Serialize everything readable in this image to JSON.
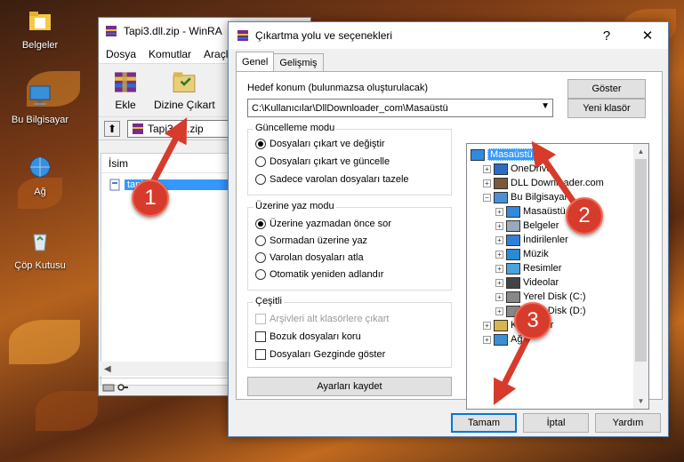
{
  "desktop": {
    "icons": [
      {
        "label": "Belgeler",
        "icon": "folder-icon"
      },
      {
        "label": "Bu Bilgisayar",
        "icon": "computer-icon"
      },
      {
        "label": "Ağ",
        "icon": "network-icon"
      },
      {
        "label": "Çöp Kutusu",
        "icon": "recycle-bin-icon"
      }
    ]
  },
  "winrar": {
    "title": "Tapi3.dll.zip - WinRA",
    "menu": [
      "Dosya",
      "Komutlar",
      "Araçla"
    ],
    "toolbar": {
      "add_label": "Ekle",
      "extract_label": "Dizine Çıkart"
    },
    "path": "Tapi3.dll.zip",
    "list_header": "İsim",
    "file_name": "tapi3.dll",
    "file_name_visible": "tapi3"
  },
  "dialog": {
    "title": "Çıkartma yolu ve seçenekleri",
    "help_glyph": "?",
    "close_glyph": "✕",
    "tabs": [
      "Genel",
      "Gelişmiş"
    ],
    "dest_label": "Hedef konum (bulunmazsa oluşturulacak)",
    "dest_value": "C:\\Kullanıcılar\\DllDownloader_com\\Masaüstü",
    "show_button": "Göster",
    "new_folder_button": "Yeni klasör",
    "update_mode": {
      "title": "Güncelleme modu",
      "options": [
        "Dosyaları çıkart ve değiştir",
        "Dosyaları çıkart ve güncelle",
        "Sadece varolan dosyaları tazele"
      ],
      "selected": 0
    },
    "overwrite_mode": {
      "title": "Üzerine yaz modu",
      "options": [
        "Üzerine yazmadan önce sor",
        "Sormadan üzerine yaz",
        "Varolan dosyaları atla",
        "Otomatik yeniden adlandır"
      ],
      "selected": 0
    },
    "misc": {
      "title": "Çeşitli",
      "options": [
        {
          "label": "Arşivleri alt klasörlere çıkart",
          "checked": false,
          "disabled": true
        },
        {
          "label": "Bozuk dosyaları koru",
          "checked": false,
          "disabled": false
        },
        {
          "label": "Dosyaları Gezginde göster",
          "checked": false,
          "disabled": false
        }
      ]
    },
    "save_settings_button": "Ayarları kaydet",
    "tree": [
      {
        "label": "Masaüstü",
        "level": 0,
        "expander": "",
        "icon": "desktop-icon",
        "selected": true
      },
      {
        "label": "OneDrive",
        "level": 1,
        "expander": "+",
        "icon": "cloud-icon"
      },
      {
        "label": "DLL Downloader.com",
        "level": 1,
        "expander": "+",
        "icon": "user-icon"
      },
      {
        "label": "Bu Bilgisayar",
        "level": 1,
        "expander": "−",
        "icon": "computer-icon"
      },
      {
        "label": "Masaüstü",
        "level": 2,
        "expander": "+",
        "icon": "desktop-icon"
      },
      {
        "label": "Belgeler",
        "level": 2,
        "expander": "+",
        "icon": "documents-icon"
      },
      {
        "label": "İndirilenler",
        "level": 2,
        "expander": "+",
        "icon": "download-icon"
      },
      {
        "label": "Müzik",
        "level": 2,
        "expander": "+",
        "icon": "music-icon"
      },
      {
        "label": "Resimler",
        "level": 2,
        "expander": "+",
        "icon": "pictures-icon"
      },
      {
        "label": "Videolar",
        "level": 2,
        "expander": "+",
        "icon": "video-icon"
      },
      {
        "label": "Yerel Disk (C:)",
        "level": 2,
        "expander": "+",
        "icon": "drive-icon"
      },
      {
        "label": "Yerel Disk (D:)",
        "level": 2,
        "expander": "+",
        "icon": "drive-icon"
      },
      {
        "label": "Kitaplıklar",
        "level": 1,
        "expander": "+",
        "icon": "library-icon"
      },
      {
        "label": "Ağ",
        "level": 1,
        "expander": "+",
        "icon": "network-icon"
      }
    ],
    "ok_button": "Tamam",
    "cancel_button": "İptal",
    "help_button": "Yardım"
  },
  "annotations": {
    "markers": [
      "1",
      "2",
      "3"
    ],
    "color": "#d63b2b"
  }
}
